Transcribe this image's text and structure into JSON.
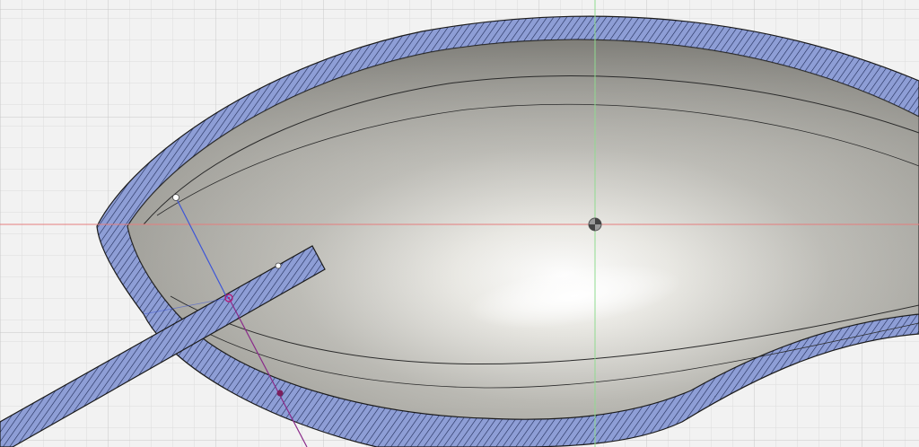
{
  "app": {
    "view": "canvas-viewport"
  },
  "colors": {
    "background": "#f2f2f2",
    "grid_minor": "#dcdcdc",
    "grid_major": "#c4c4c4",
    "axis_x": "#e57d7d",
    "axis_y": "#8fdc8f",
    "section_fill": "#8e9ed6",
    "section_hatch": "#1e2a55",
    "edge": "#1b1b1b",
    "sketch_line": "#3d55d8",
    "constraint_line": "#8a2a8a",
    "point_dark": "#7b1f5e",
    "surface_mid": "#b8b7b1",
    "surface_dark": "#7d7c77",
    "surface_light": "#ffffff"
  },
  "icons": {
    "origin": "origin-marker-icon",
    "sketch_point": "sketch-point-icon",
    "constraint_point": "constraint-point-icon"
  }
}
